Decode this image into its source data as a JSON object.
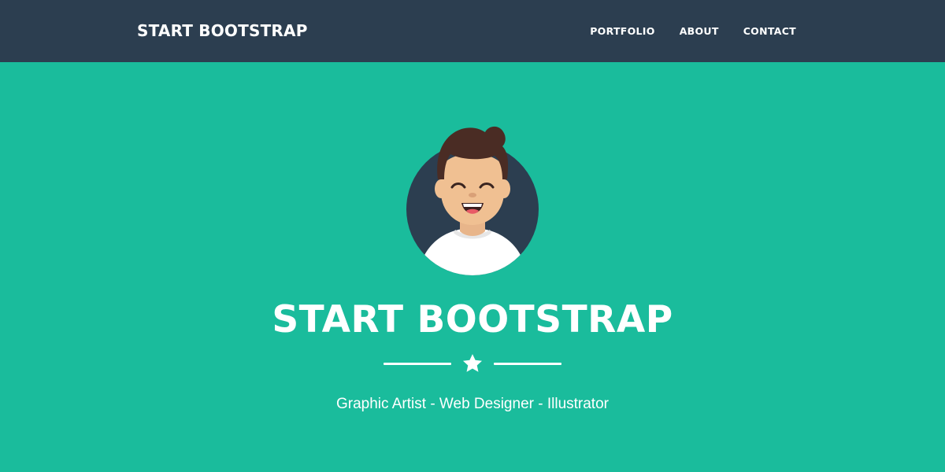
{
  "navbar": {
    "brand": "START BOOTSTRAP",
    "links": [
      "PORTFOLIO",
      "ABOUT",
      "CONTACT"
    ]
  },
  "masthead": {
    "title": "START BOOTSTRAP",
    "subtitle": "Graphic Artist - Web Designer - Illustrator",
    "divider_icon": "star-icon",
    "avatar_icon": "avatar-illustration"
  },
  "colors": {
    "primary": "#1abc9c",
    "secondary": "#2c3e50",
    "text": "#ffffff"
  }
}
